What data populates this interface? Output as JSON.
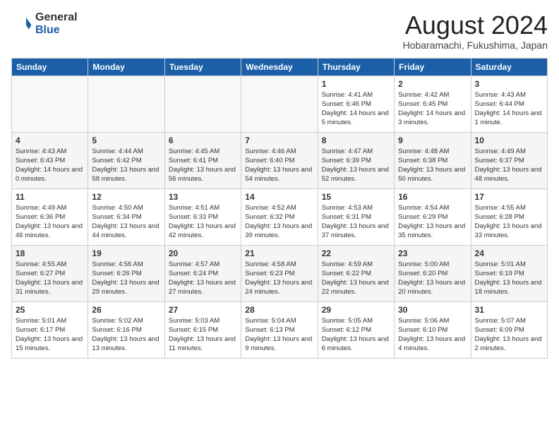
{
  "header": {
    "logo_general": "General",
    "logo_blue": "Blue",
    "month_title": "August 2024",
    "subtitle": "Hobaramachi, Fukushima, Japan"
  },
  "calendar": {
    "days_of_week": [
      "Sunday",
      "Monday",
      "Tuesday",
      "Wednesday",
      "Thursday",
      "Friday",
      "Saturday"
    ],
    "weeks": [
      [
        {
          "day": "",
          "info": ""
        },
        {
          "day": "",
          "info": ""
        },
        {
          "day": "",
          "info": ""
        },
        {
          "day": "",
          "info": ""
        },
        {
          "day": "1",
          "info": "Sunrise: 4:41 AM\nSunset: 6:46 PM\nDaylight: 14 hours\nand 5 minutes."
        },
        {
          "day": "2",
          "info": "Sunrise: 4:42 AM\nSunset: 6:45 PM\nDaylight: 14 hours\nand 3 minutes."
        },
        {
          "day": "3",
          "info": "Sunrise: 4:43 AM\nSunset: 6:44 PM\nDaylight: 14 hours\nand 1 minute."
        }
      ],
      [
        {
          "day": "4",
          "info": "Sunrise: 4:43 AM\nSunset: 6:43 PM\nDaylight: 14 hours\nand 0 minutes."
        },
        {
          "day": "5",
          "info": "Sunrise: 4:44 AM\nSunset: 6:42 PM\nDaylight: 13 hours\nand 58 minutes."
        },
        {
          "day": "6",
          "info": "Sunrise: 4:45 AM\nSunset: 6:41 PM\nDaylight: 13 hours\nand 56 minutes."
        },
        {
          "day": "7",
          "info": "Sunrise: 4:46 AM\nSunset: 6:40 PM\nDaylight: 13 hours\nand 54 minutes."
        },
        {
          "day": "8",
          "info": "Sunrise: 4:47 AM\nSunset: 6:39 PM\nDaylight: 13 hours\nand 52 minutes."
        },
        {
          "day": "9",
          "info": "Sunrise: 4:48 AM\nSunset: 6:38 PM\nDaylight: 13 hours\nand 50 minutes."
        },
        {
          "day": "10",
          "info": "Sunrise: 4:49 AM\nSunset: 6:37 PM\nDaylight: 13 hours\nand 48 minutes."
        }
      ],
      [
        {
          "day": "11",
          "info": "Sunrise: 4:49 AM\nSunset: 6:36 PM\nDaylight: 13 hours\nand 46 minutes."
        },
        {
          "day": "12",
          "info": "Sunrise: 4:50 AM\nSunset: 6:34 PM\nDaylight: 13 hours\nand 44 minutes."
        },
        {
          "day": "13",
          "info": "Sunrise: 4:51 AM\nSunset: 6:33 PM\nDaylight: 13 hours\nand 42 minutes."
        },
        {
          "day": "14",
          "info": "Sunrise: 4:52 AM\nSunset: 6:32 PM\nDaylight: 13 hours\nand 39 minutes."
        },
        {
          "day": "15",
          "info": "Sunrise: 4:53 AM\nSunset: 6:31 PM\nDaylight: 13 hours\nand 37 minutes."
        },
        {
          "day": "16",
          "info": "Sunrise: 4:54 AM\nSunset: 6:29 PM\nDaylight: 13 hours\nand 35 minutes."
        },
        {
          "day": "17",
          "info": "Sunrise: 4:55 AM\nSunset: 6:28 PM\nDaylight: 13 hours\nand 33 minutes."
        }
      ],
      [
        {
          "day": "18",
          "info": "Sunrise: 4:55 AM\nSunset: 6:27 PM\nDaylight: 13 hours\nand 31 minutes."
        },
        {
          "day": "19",
          "info": "Sunrise: 4:56 AM\nSunset: 6:26 PM\nDaylight: 13 hours\nand 29 minutes."
        },
        {
          "day": "20",
          "info": "Sunrise: 4:57 AM\nSunset: 6:24 PM\nDaylight: 13 hours\nand 27 minutes."
        },
        {
          "day": "21",
          "info": "Sunrise: 4:58 AM\nSunset: 6:23 PM\nDaylight: 13 hours\nand 24 minutes."
        },
        {
          "day": "22",
          "info": "Sunrise: 4:59 AM\nSunset: 6:22 PM\nDaylight: 13 hours\nand 22 minutes."
        },
        {
          "day": "23",
          "info": "Sunrise: 5:00 AM\nSunset: 6:20 PM\nDaylight: 13 hours\nand 20 minutes."
        },
        {
          "day": "24",
          "info": "Sunrise: 5:01 AM\nSunset: 6:19 PM\nDaylight: 13 hours\nand 18 minutes."
        }
      ],
      [
        {
          "day": "25",
          "info": "Sunrise: 5:01 AM\nSunset: 6:17 PM\nDaylight: 13 hours\nand 15 minutes."
        },
        {
          "day": "26",
          "info": "Sunrise: 5:02 AM\nSunset: 6:16 PM\nDaylight: 13 hours\nand 13 minutes."
        },
        {
          "day": "27",
          "info": "Sunrise: 5:03 AM\nSunset: 6:15 PM\nDaylight: 13 hours\nand 11 minutes."
        },
        {
          "day": "28",
          "info": "Sunrise: 5:04 AM\nSunset: 6:13 PM\nDaylight: 13 hours\nand 9 minutes."
        },
        {
          "day": "29",
          "info": "Sunrise: 5:05 AM\nSunset: 6:12 PM\nDaylight: 13 hours\nand 6 minutes."
        },
        {
          "day": "30",
          "info": "Sunrise: 5:06 AM\nSunset: 6:10 PM\nDaylight: 13 hours\nand 4 minutes."
        },
        {
          "day": "31",
          "info": "Sunrise: 5:07 AM\nSunset: 6:09 PM\nDaylight: 13 hours\nand 2 minutes."
        }
      ]
    ]
  }
}
